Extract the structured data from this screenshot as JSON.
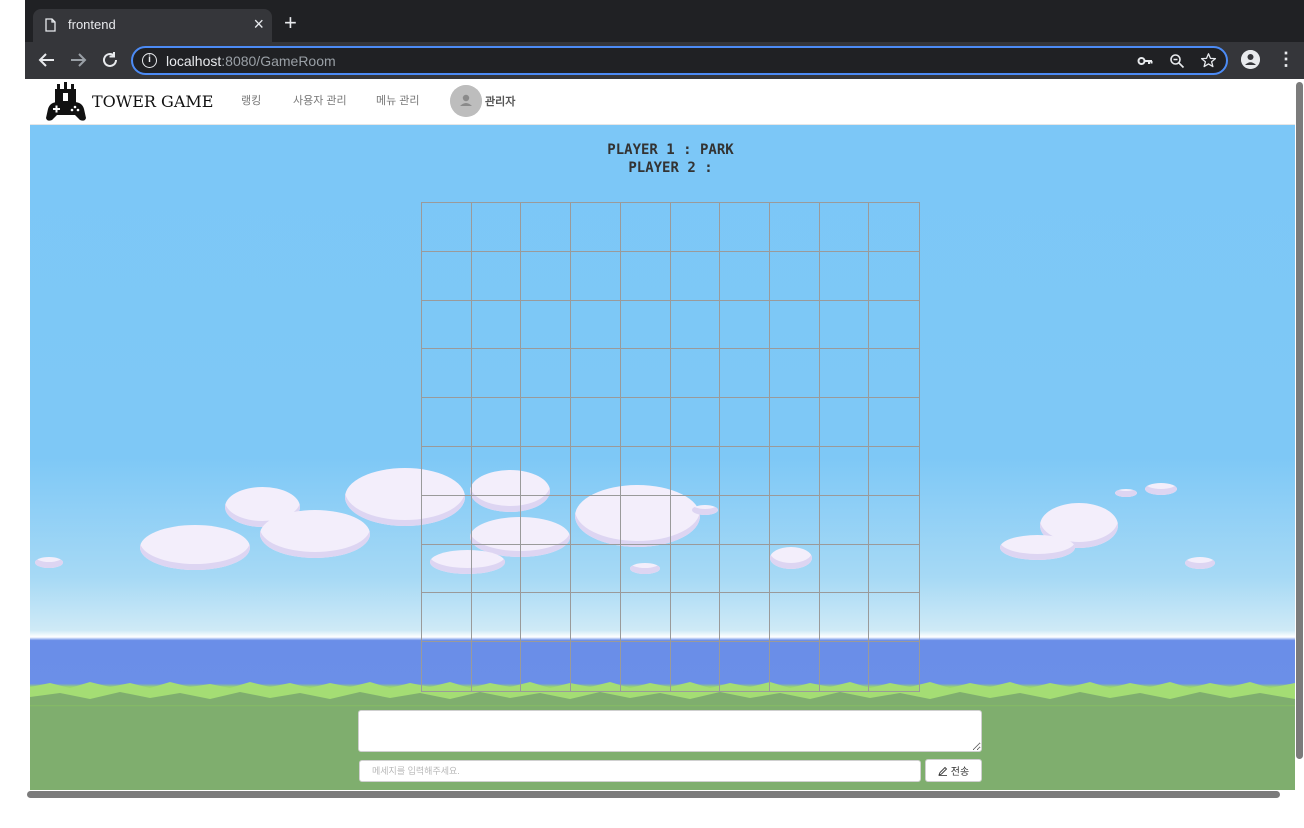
{
  "browser": {
    "tab_title": "frontend",
    "tab_close": "×",
    "new_tab": "+",
    "url_host": "localhost",
    "url_path": ":8080/GameRoom",
    "icons": [
      "file-icon",
      "close-icon",
      "plus-icon",
      "back-arrow-icon",
      "forward-arrow-icon",
      "reload-icon",
      "info-icon",
      "key-icon",
      "zoom-icon",
      "star-icon",
      "profile-icon",
      "more-vert-icon"
    ]
  },
  "header": {
    "brand": "TOWER GAME",
    "menu": [
      "랭킹",
      "사용자 관리",
      "메뉴 관리"
    ],
    "user_label": "관리자"
  },
  "game": {
    "player1_label": "PLAYER 1 : PARK",
    "player2_label": "PLAYER 2 :",
    "board_rows": 10,
    "board_cols": 10
  },
  "chat": {
    "input_placeholder": "메세지를 입력해주세요.",
    "send_label": "전송"
  },
  "colors": {
    "sky": "#7cc7f7",
    "sea": "#6a8ee8",
    "grass": "#8ac95b",
    "ground": "#7fae6e",
    "chrome_dark": "#35363a",
    "omnibox_focus": "#4c8bf5"
  }
}
